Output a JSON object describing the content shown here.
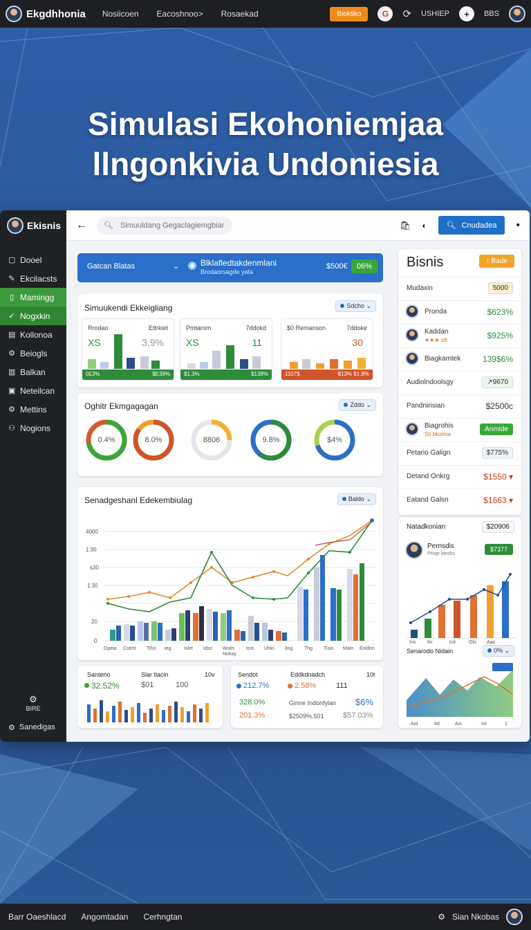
{
  "topbar": {
    "brand": "Ekgdhhonia",
    "nav": [
      "Nosiicoen",
      "Eacoshnoo>",
      "Rosaekad"
    ],
    "orange_btn": "Bioktiko",
    "user_label": "USHIEP",
    "plus_label": "+",
    "short": "BBS"
  },
  "hero": {
    "line1": "Simulasi Ekohoniemjaa",
    "line2": "llngonkivia Undoniesia"
  },
  "sidebar": {
    "brand": "Ekisnis",
    "items": [
      {
        "label": "Dooel",
        "icon": "square-icon"
      },
      {
        "label": "Ekcilacsts",
        "icon": "pencil-icon"
      },
      {
        "label": "Mamingg",
        "icon": "phone-icon",
        "active": true
      },
      {
        "label": "Nogxkin",
        "icon": "check-icon",
        "active2": true
      },
      {
        "label": "Kollonoa",
        "icon": "doc-icon"
      },
      {
        "label": "Beiogls",
        "icon": "gear-icon"
      },
      {
        "label": "Balkan",
        "icon": "book-icon"
      },
      {
        "label": "Neteilcan",
        "icon": "box-icon"
      },
      {
        "label": "Mettins",
        "icon": "gear-icon"
      },
      {
        "label": "Nogions",
        "icon": "users-icon"
      }
    ],
    "bottom1": "BIRE",
    "bottom2": "Sanedigas"
  },
  "appbar": {
    "search_placeholder": "Simuuldang Gegaclagiemgbian",
    "action_btn": "Cnudadea"
  },
  "bluebar": {
    "select": "Gatcan Blatas",
    "title": "Blklafledtakdenmlani",
    "subtitle": "Brodaorsagde yafa",
    "value": "$500€",
    "badge": "06%"
  },
  "sim_card": {
    "title": "Simuukendi Ekkeigliang",
    "pill": "Sdcho",
    "minis": [
      {
        "l1": "Rrodao",
        "l2": "Ettrkiet",
        "big": "XS",
        "big2": "3,9%",
        "f1": "0£3%",
        "f2": "$E39%",
        "foot": "#2e8b3a"
      },
      {
        "l1": "Pmtarom",
        "l2": "7ddokd",
        "big": "XS",
        "big2": "11",
        "f1": "$1,3%",
        "f2": "$138%",
        "foot": "#2e8b3a"
      },
      {
        "l1": "$0 Remanson",
        "l2": "7ddoke",
        "big": "",
        "big2": "30",
        "f1": "1107$",
        "f2": "$13%  $1,8%",
        "foot": "#d0542a"
      }
    ]
  },
  "ring_card": {
    "title": "Oghitr Ekmgagagan",
    "pill": "Zddo",
    "rings": [
      {
        "label": "0.4%",
        "p": 72,
        "c": "#3aa63a",
        "c2": "#d55a2a"
      },
      {
        "label": "8.0%",
        "p": 85,
        "c": "#d0542a",
        "c2": "#f0a030"
      },
      {
        "label": "8806",
        "p": 25,
        "c": "#f2b134",
        "c2": "#e3e6ea"
      },
      {
        "label": "9.8%",
        "p": 60,
        "c": "#2e8b3a",
        "c2": "#2b6fc9"
      },
      {
        "label": "$4%",
        "p": 70,
        "c": "#2b6fc9",
        "c2": "#a8d24a"
      }
    ]
  },
  "main_chart": {
    "title": "Senadgeshanl Edekembiulag",
    "pill": "Baldo"
  },
  "bottom_left": {
    "t1": "Santeno",
    "t2": "Slar tlacin",
    "t3": "10v",
    "v1": "32.52%",
    "v2": "$01",
    "v3": "100"
  },
  "bottom_right": {
    "t1": "Sendot",
    "t2": "Eddkdnadch",
    "t3": "10t",
    "r1a": "212.7%",
    "r1b": "2.58%",
    "r1c": "111",
    "r2a": "328.0%",
    "r2b": "Ginne Indonfylan",
    "r2c": "$6%",
    "r3a": "201.3%",
    "r3b": "$2509%.501",
    "r3c": "$57.03%"
  },
  "right_panel": {
    "title": "Bisnis",
    "title_btn": "Bade",
    "rows": [
      {
        "name": "Mudaxin",
        "tag": "5000",
        "tagcolor": "#fbeecb"
      },
      {
        "name": "Pronda",
        "value": "$623%",
        "vcolor": "#2e8b3a",
        "av": true
      },
      {
        "name": "Kaddan",
        "value": "$925%",
        "vcolor": "#2e8b3a",
        "av": true,
        "sub": "★★★ ±8"
      },
      {
        "name": "Biagkamtek",
        "value": "139$6%",
        "vcolor": "#2e8b3a",
        "av": true
      },
      {
        "name": "Audiolndoolsgy",
        "tag": "↗9670",
        "tagcolor": "#eaf6ea"
      },
      {
        "name": "Pandnirisian",
        "value": "$2500c",
        "vcolor": "#333"
      },
      {
        "name": "Biagrohis",
        "btn": "Anmide",
        "av": true,
        "sub": "Sti bkonna"
      },
      {
        "name": "Petario Galign",
        "tag": "$775%",
        "tagcolor": "#eef1f7"
      },
      {
        "name": "Detand Onkrg",
        "value": "$1550 ▾",
        "vcolor": "#c03a1a"
      },
      {
        "name": "Eatand Galsn",
        "value": "$1663 ▾",
        "vcolor": "#c03a1a"
      }
    ]
  },
  "right_panel2": {
    "head": "Natadkonian",
    "head_tag": "$20906",
    "person": "Pernsdis",
    "person_sub": "Phiqe bleoks",
    "person_btn": "$7377",
    "sub_title": "Senarodo Nidain",
    "sub_pill": "0%"
  },
  "footer": {
    "links": [
      "Barr Oaeshlacd",
      "Angomtadan",
      "Cerhngtan"
    ],
    "right": "Sian Nkobas"
  }
}
